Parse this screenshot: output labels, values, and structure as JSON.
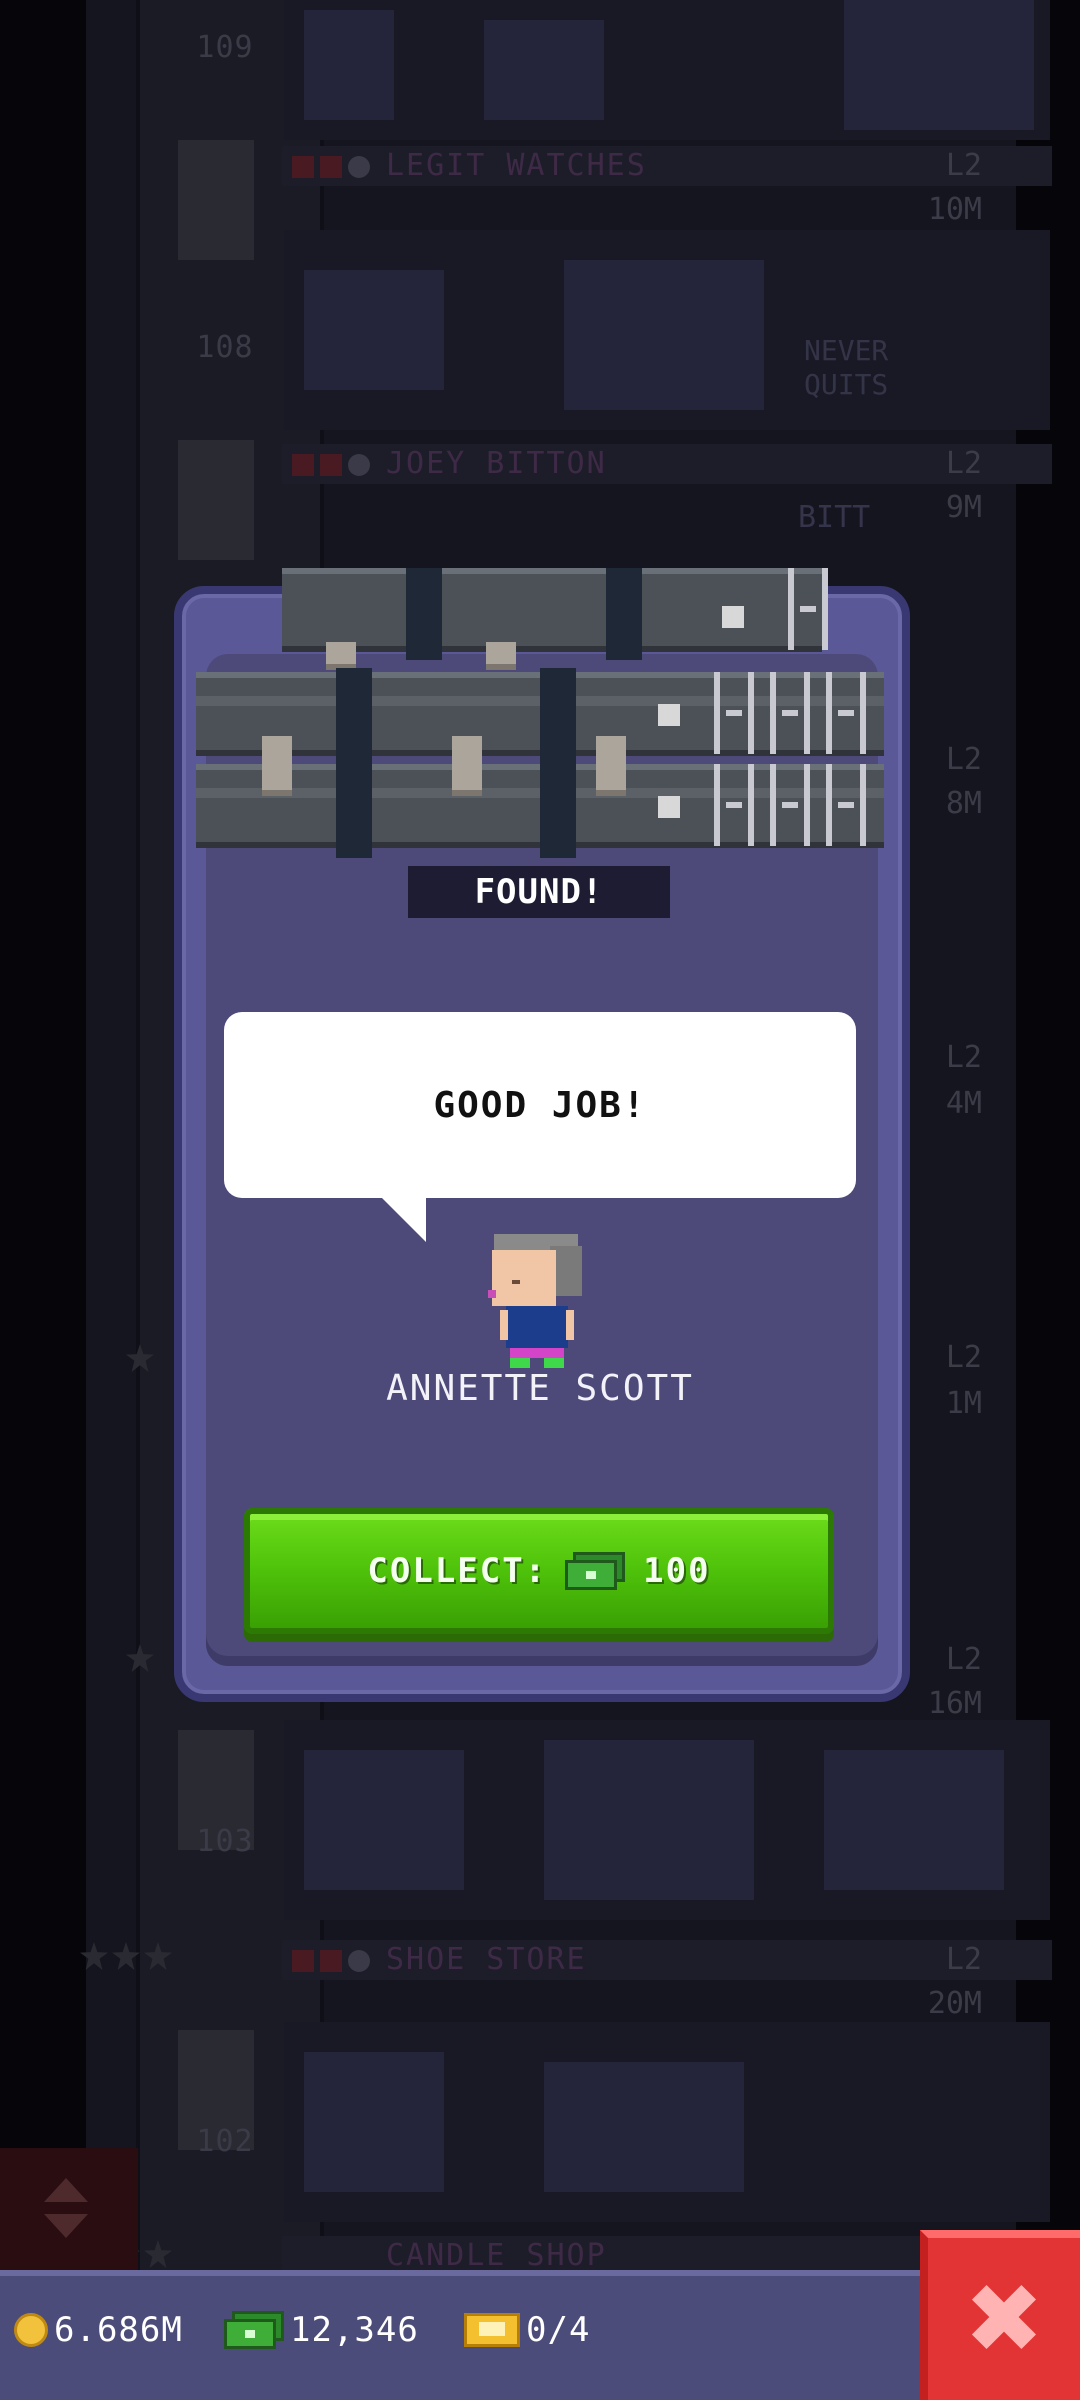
{
  "floors": [
    {
      "number": "109",
      "name": "",
      "level": "",
      "income": ""
    },
    {
      "number": "108",
      "name": "LEGIT WATCHES",
      "level": "L2",
      "income": "10M"
    },
    {
      "number": "",
      "name": "JOEY BITTON",
      "level": "L2",
      "income": "9M"
    },
    {
      "number": "103",
      "name": "",
      "level": "L2",
      "income": "16M"
    },
    {
      "number": "102",
      "name": "SHOE STORE",
      "level": "L2",
      "income": "20M"
    },
    {
      "number": "",
      "name": "CANDLE SHOP",
      "level": "",
      "income": ""
    }
  ],
  "side_incomes": [
    "8M",
    "4M",
    "1M"
  ],
  "side_levels": [
    "L2",
    "L2",
    "L2"
  ],
  "signage": {
    "line1": "NEVER",
    "line2": "QUITS",
    "bitt": "BITT"
  },
  "modal": {
    "found_label": "FOUND!",
    "speech": "GOOD JOB!",
    "npc_name": "ANNETTE SCOTT",
    "collect_label": "COLLECT:",
    "collect_amount": "100"
  },
  "status_bar": {
    "coins": "6.686M",
    "bux": "12,346",
    "tickets": "0/4"
  },
  "colors": {
    "modal_bg": "#5b5897",
    "collect_green": "#4ec20a",
    "close_red": "#e23434",
    "status_bar": "#4c4c7a"
  },
  "icons": [
    "coin-icon",
    "bux-icon",
    "ticket-icon",
    "close-icon",
    "elevator-arrows-icon",
    "star-icon",
    "clock-icon"
  ]
}
